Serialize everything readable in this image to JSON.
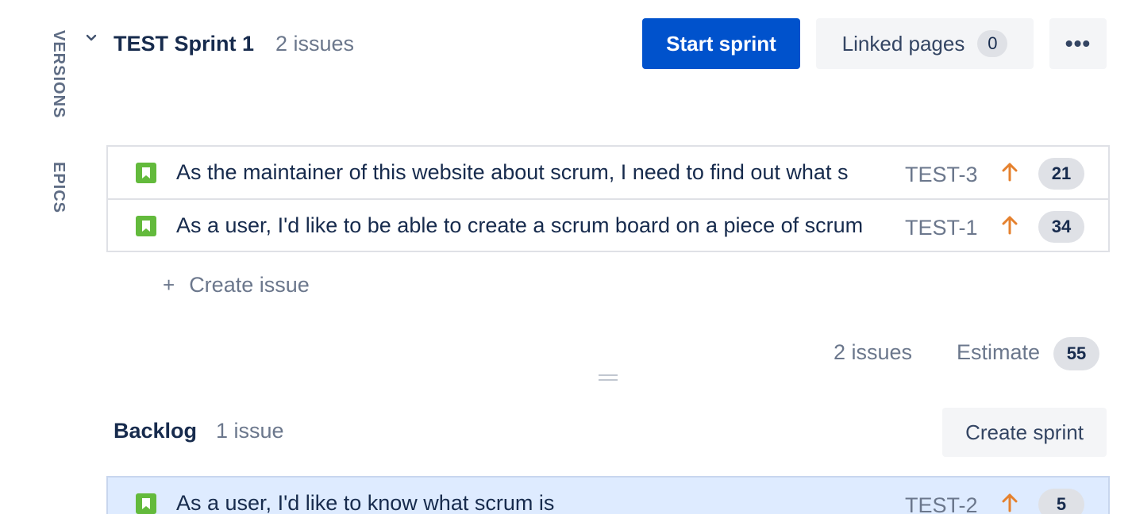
{
  "sidebar": {
    "tabs": [
      {
        "label": "VERSIONS"
      },
      {
        "label": "EPICS"
      }
    ]
  },
  "sprint": {
    "title": "TEST Sprint 1",
    "issue_count": "2 issues",
    "start_label": "Start sprint",
    "linked_pages_label": "Linked pages",
    "linked_pages_count": "0",
    "more_label": "•••",
    "issues": [
      {
        "summary": "As the maintainer of this website about scrum, I need to find out what s",
        "key": "TEST-3",
        "estimate": "21"
      },
      {
        "summary": "As a user, I'd like to be able to create a scrum board on a piece of scrum",
        "key": "TEST-1",
        "estimate": "34"
      }
    ],
    "create_issue_icon": "+",
    "create_issue_label": "Create issue",
    "footer_issue_count": "2 issues",
    "footer_estimate_label": "Estimate",
    "footer_estimate_value": "55"
  },
  "backlog": {
    "title": "Backlog",
    "issue_count": "1 issue",
    "create_sprint_label": "Create sprint",
    "issues": [
      {
        "summary": "As a user, I'd like to know what scrum is",
        "key": "TEST-2",
        "estimate": "5"
      }
    ]
  },
  "icons": {
    "chevron": "chevron-down-icon",
    "story": "story-bookmark-icon",
    "priority": "priority-high-arrow-icon",
    "drag": "drag-handle-icon"
  },
  "colors": {
    "primary": "#0052cc",
    "story": "#63ba3c",
    "priority_high": "#e5812e",
    "selected_row": "#deebff"
  }
}
